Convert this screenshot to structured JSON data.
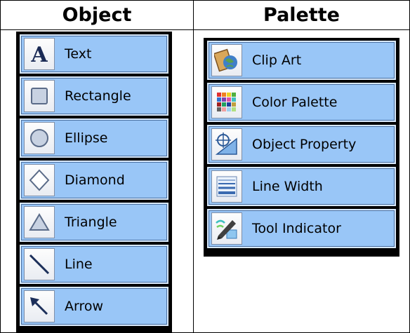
{
  "headers": {
    "object": "Object",
    "palette": "Palette"
  },
  "object_tools": [
    {
      "label": "Text",
      "icon": "text-icon"
    },
    {
      "label": "Rectangle",
      "icon": "rectangle-icon"
    },
    {
      "label": "Ellipse",
      "icon": "ellipse-icon"
    },
    {
      "label": "Diamond",
      "icon": "diamond-icon"
    },
    {
      "label": "Triangle",
      "icon": "triangle-icon"
    },
    {
      "label": "Line",
      "icon": "line-icon"
    },
    {
      "label": "Arrow",
      "icon": "arrow-icon"
    }
  ],
  "palette_tools": [
    {
      "label": "Clip Art",
      "icon": "clip-art-icon"
    },
    {
      "label": "Color Palette",
      "icon": "color-palette-icon"
    },
    {
      "label": "Object Property",
      "icon": "object-property-icon"
    },
    {
      "label": "Line Width",
      "icon": "line-width-icon"
    },
    {
      "label": "Tool Indicator",
      "icon": "tool-indicator-icon"
    }
  ],
  "colors": {
    "button_fill": "#99c6f7",
    "panel_bg": "#000000"
  }
}
